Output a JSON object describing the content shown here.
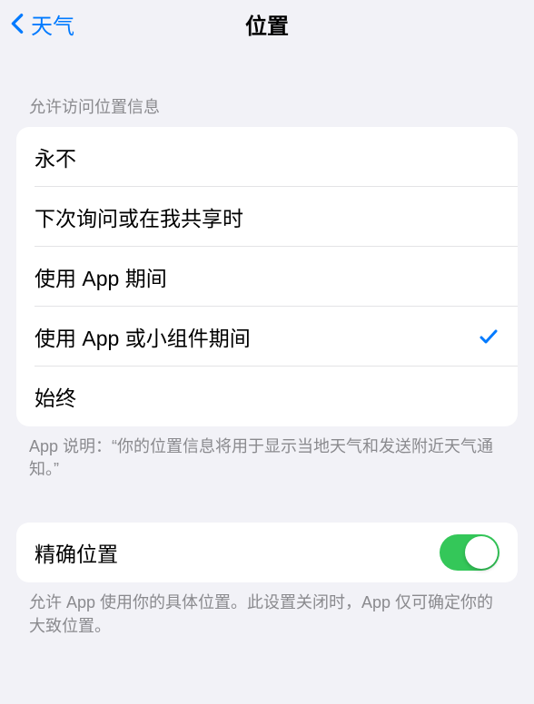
{
  "header": {
    "back_label": "天气",
    "title": "位置"
  },
  "location_access": {
    "section_header": "允许访问位置信息",
    "options": [
      {
        "label": "永不",
        "selected": false
      },
      {
        "label": "下次询问或在我共享时",
        "selected": false
      },
      {
        "label": "使用 App 期间",
        "selected": false
      },
      {
        "label": "使用 App 或小组件期间",
        "selected": true
      },
      {
        "label": "始终",
        "selected": false
      }
    ],
    "footer": "App 说明：“你的位置信息将用于显示当地天气和发送附近天气通知。”"
  },
  "precise_location": {
    "label": "精确位置",
    "enabled": true,
    "footer": "允许 App 使用你的具体位置。此设置关闭时，App 仅可确定你的大致位置。"
  }
}
